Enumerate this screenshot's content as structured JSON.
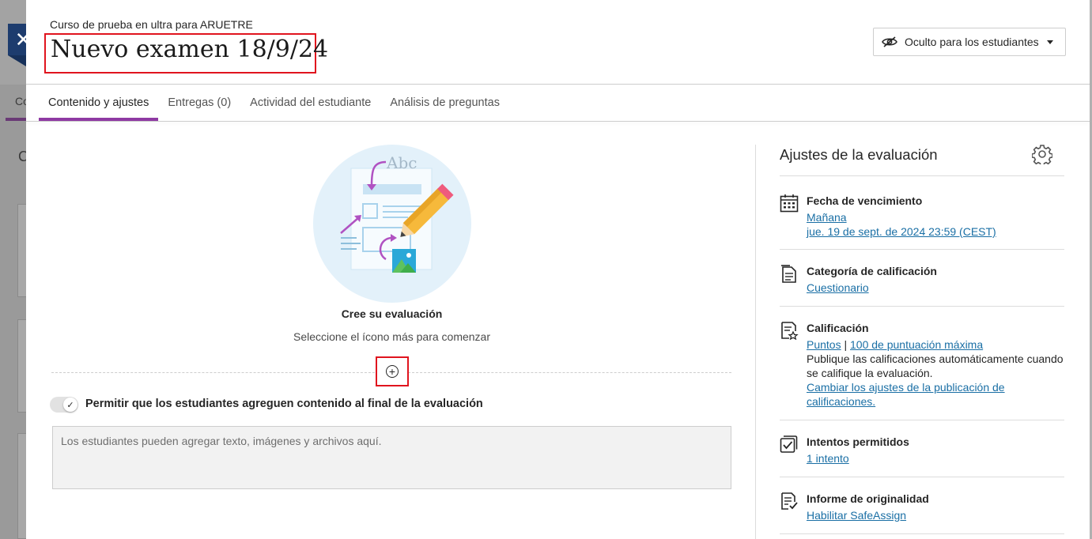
{
  "background": {
    "tab_text": "Co",
    "letter": "C"
  },
  "header": {
    "close_label": "✕",
    "course_name": "Curso de prueba en ultra para ARUETRE",
    "title": "Nuevo examen 18/9/24",
    "visibility_label": "Oculto para los estudiantes"
  },
  "tabs": [
    {
      "label": "Contenido y ajustes",
      "active": true
    },
    {
      "label": "Entregas (0)",
      "active": false
    },
    {
      "label": "Actividad del estudiante",
      "active": false
    },
    {
      "label": "Análisis de preguntas",
      "active": false
    }
  ],
  "content": {
    "illustration_text": "Abc",
    "create_title": "Cree su evaluación",
    "create_subtitle": "Seleccione el ícono más para comenzar",
    "plus_symbol": "+",
    "toggle_check": "✓",
    "allow_label": "Permitir que los estudiantes agreguen contenido al final de la evaluación",
    "textarea_placeholder": "Los estudiantes pueden agregar texto, imágenes y archivos aquí."
  },
  "settings": {
    "title": "Ajustes de la evaluación",
    "due_date": {
      "label": "Fecha de vencimiento",
      "relative": "Mañana",
      "date": "jue. 19 de sept. de 2024 23:59 (CEST)"
    },
    "grade_category": {
      "label": "Categoría de calificación",
      "value": "Cuestionario"
    },
    "grading": {
      "label": "Calificación",
      "scheme": "Puntos",
      "separator": "|",
      "max_points": "100 de puntuación máxima",
      "description": "Publique las calificaciones automáticamente cuando se califique la evaluación.",
      "change_link": "Cambiar los ajustes de la publicación de calificaciones."
    },
    "attempts": {
      "label": "Intentos permitidos",
      "value": "1 intento"
    },
    "originality": {
      "label": "Informe de originalidad",
      "value": "Habilitar SafeAssign"
    }
  },
  "colors": {
    "accent_purple": "#8f3aa3",
    "link_blue": "#1a6fa5",
    "highlight_red": "#e0141e",
    "close_navy": "#1d3c6e"
  }
}
